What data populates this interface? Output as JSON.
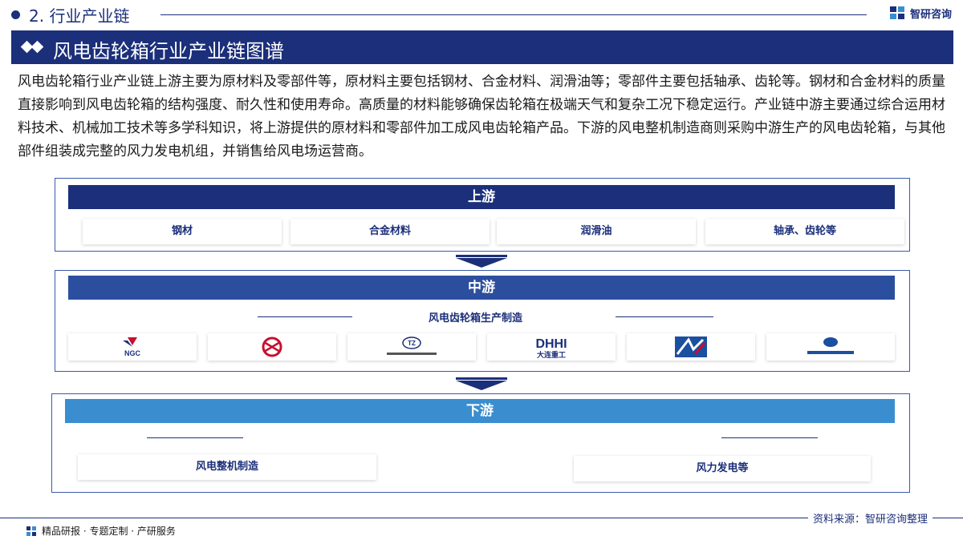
{
  "header": {
    "section": "2. 行业产业链",
    "brand": "智研咨询"
  },
  "title": "风电齿轮箱行业产业链图谱",
  "intro": "风电齿轮箱行业产业链上游主要为原材料及零部件等，原材料主要包括钢材、合金材料、润滑油等；零部件主要包括轴承、齿轮等。钢材和合金材料的质量直接影响到风电齿轮箱的结构强度、耐久性和使用寿命。高质量的材料能够确保齿轮箱在极端天气和复杂工况下稳定运行。产业链中游主要通过综合运用材料技术、机械加工技术等多学科知识，将上游提供的原材料和零部件加工成风电齿轮箱产品。下游的风电整机制造商则采购中游生产的风电齿轮箱，与其他部件组装成完整的风力发电机组，并销售给风电场运营商。",
  "upstream": {
    "label": "上游",
    "items": [
      "钢材",
      "合金材料",
      "润滑油",
      "轴承、齿轮等"
    ]
  },
  "midstream": {
    "label": "中游",
    "subtitle": "风电齿轮箱生产制造",
    "logos": [
      {
        "text": "NGC",
        "icon": "ngc-logo"
      },
      {
        "text": "",
        "icon": "red-emblem-logo"
      },
      {
        "text": "TZ",
        "icon": "tz-logo"
      },
      {
        "text": "DHHI",
        "sub": "大连重工",
        "icon": "dhhi-logo"
      },
      {
        "text": "",
        "icon": "blue-square-logo"
      },
      {
        "text": "",
        "icon": "blue-oval-logo"
      }
    ]
  },
  "downstream": {
    "label": "下游",
    "items": [
      "风电整机制造",
      "风力发电等"
    ]
  },
  "footer": {
    "source": "资料来源：智研咨询整理",
    "tagline": "精品研报 · 专题定制 · 产研服务"
  },
  "colors": {
    "navy": "#1b2f7a",
    "mid_blue": "#2c4e9e",
    "light_blue": "#3a8ed0"
  }
}
